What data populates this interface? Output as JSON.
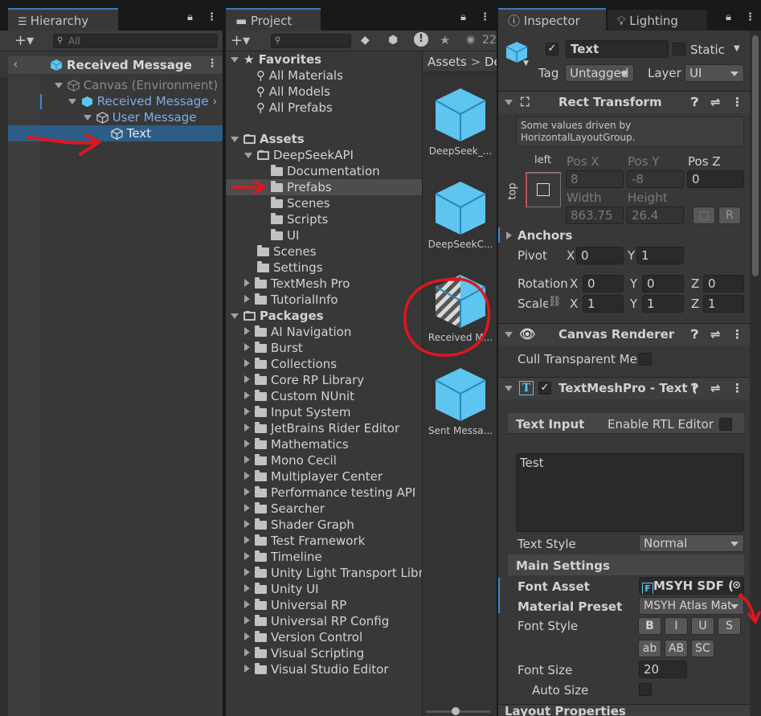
{
  "hierarchy": {
    "tab_label": "Hierarchy",
    "search_placeholder": "All",
    "header_title": "Received Message",
    "items": [
      {
        "label": "Canvas (Environment)"
      },
      {
        "label": "Received Message"
      },
      {
        "label": "User Message"
      },
      {
        "label": "Text"
      }
    ]
  },
  "project": {
    "tab_label": "Project",
    "count": "22",
    "breadcrumb": {
      "root": "Assets",
      "sep": ">",
      "current": "De"
    },
    "favorites": {
      "label": "Favorites",
      "items": [
        "All Materials",
        "All Models",
        "All Prefabs"
      ]
    },
    "assets": {
      "label": "Assets",
      "deepseek": {
        "label": "DeepSeekAPI",
        "children": [
          "Documentation",
          "Prefabs",
          "Scenes",
          "Scripts",
          "UI"
        ]
      },
      "others": [
        "Scenes",
        "Settings",
        "TextMesh Pro",
        "TutorialInfo"
      ]
    },
    "packages": {
      "label": "Packages",
      "items": [
        "AI Navigation",
        "Burst",
        "Collections",
        "Core RP Library",
        "Custom NUnit",
        "Input System",
        "JetBrains Rider Editor",
        "Mathematics",
        "Mono Cecil",
        "Multiplayer Center",
        "Performance testing API",
        "Searcher",
        "Shader Graph",
        "Test Framework",
        "Timeline",
        "Unity Light Transport Libra",
        "Unity UI",
        "Universal RP",
        "Universal RP Config",
        "Version Control",
        "Visual Scripting",
        "Visual Studio Editor"
      ]
    },
    "grid_assets": [
      "DeepSeek_...",
      "DeepSeekC...",
      "Received M...",
      "Sent Messa..."
    ]
  },
  "inspector": {
    "tab_label": "Inspector",
    "tab2_label": "Lighting",
    "object": {
      "name": "Text",
      "static_label": "Static",
      "tag_label": "Tag",
      "tag_value": "Untagged",
      "layer_label": "Layer",
      "layer_value": "UI"
    },
    "rect_transform": {
      "title": "Rect Transform",
      "info": "Some values driven by HorizontalLayoutGroup.",
      "anchor_h": "left",
      "anchor_v": "top",
      "pos_x_label": "Pos X",
      "pos_x": "8",
      "pos_y_label": "Pos Y",
      "pos_y": "-8",
      "pos_z_label": "Pos Z",
      "pos_z": "0",
      "width_label": "Width",
      "width": "863.75",
      "height_label": "Height",
      "height": "26.4",
      "r_button": "R",
      "anchors_label": "Anchors",
      "pivot_label": "Pivot",
      "pivot_x": "0",
      "pivot_y": "1",
      "rotation_label": "Rotation",
      "rot_x": "0",
      "rot_y": "0",
      "rot_z": "0",
      "scale_label": "Scale",
      "scale_x": "1",
      "scale_y": "1",
      "scale_z": "1",
      "x": "X",
      "y": "Y",
      "z": "Z"
    },
    "canvas_renderer": {
      "title": "Canvas Renderer",
      "cull_label": "Cull Transparent Mes"
    },
    "tmp": {
      "title": "TextMeshPro - Text (",
      "text_input_label": "Text Input",
      "rtl_label": "Enable RTL Editor",
      "text_value": "Test",
      "text_style_label": "Text Style",
      "text_style_value": "Normal",
      "main_settings_label": "Main Settings",
      "font_asset_label": "Font Asset",
      "font_asset_value": "MSYH SDF (",
      "material_preset_label": "Material Preset",
      "material_preset_value": "MSYH Atlas Mat",
      "font_style_label": "Font Style",
      "style_buttons": [
        "B",
        "I",
        "U",
        "S",
        "ab",
        "AB",
        "SC"
      ],
      "font_size_label": "Font Size",
      "font_size_value": "20",
      "auto_size_label": "Auto Size"
    },
    "layout_properties_label": "Layout Properties"
  },
  "colors": {
    "selection": "#2c5d87",
    "accent_blue": "#7baee8",
    "annotation_red": "#e0161e",
    "cube": "#5ec4f0"
  }
}
